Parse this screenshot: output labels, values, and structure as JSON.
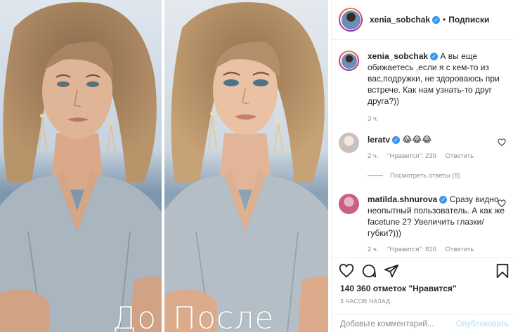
{
  "photo": {
    "before_caption": "До",
    "after_caption": "После"
  },
  "header": {
    "username": "xenia_sobchak",
    "separator": "•",
    "follow_label": "Подписки"
  },
  "caption": {
    "username": "xenia_sobchak",
    "text": "А вы еще обижаетесь ,если я с кем-то из вас,подружки, не здороваюсь при встрече. Как нам узнать-то друг друга?))",
    "time": "3 ч."
  },
  "comments": [
    {
      "username": "leratv",
      "text": "😂😂😂",
      "time": "2 ч.",
      "likes": "\"Нравится\": 239",
      "reply_label": "Ответить"
    },
    {
      "username": "matilda.shnurova",
      "text": "Сразу видно неопытный пользователь. А как же facetune 2? Увеличить глазки/губки?)))",
      "time": "2 ч.",
      "likes": "\"Нравится\": 816",
      "reply_label": "Ответить"
    }
  ],
  "view_replies": "Посмотреть ответы (8)",
  "actions": {
    "likes_text": "140 360 отметок \"Нравится\"",
    "time_ago": "3 ЧАСОВ НАЗАД"
  },
  "add_comment": {
    "placeholder": "Добавьте комментарий...",
    "post_label": "Опубликовать"
  },
  "colors": {
    "verified": "#3897f0",
    "muted": "#8e8e8e",
    "text": "#262626",
    "post_disabled": "#b2dffc"
  },
  "icons": [
    "heart-icon",
    "comment-icon",
    "share-icon",
    "bookmark-icon",
    "verified-icon"
  ]
}
